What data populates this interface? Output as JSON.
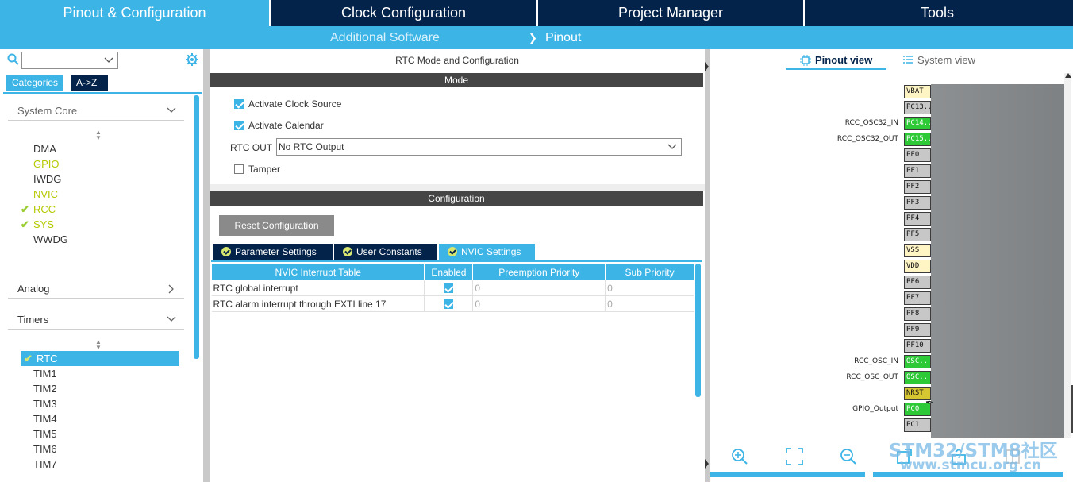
{
  "top_tabs": [
    "Pinout & Configuration",
    "Clock Configuration",
    "Project Manager",
    "Tools"
  ],
  "sub_menu": {
    "additional_software": "Additional Software",
    "pinout": "Pinout"
  },
  "left": {
    "search_value": "",
    "category_tab": "Categories",
    "az_tab": "A->Z",
    "system_core": {
      "label": "System Core",
      "items": [
        "DMA",
        "GPIO",
        "IWDG",
        "NVIC",
        "RCC",
        "SYS",
        "WWDG"
      ]
    },
    "analog": {
      "label": "Analog"
    },
    "timers": {
      "label": "Timers",
      "items": [
        "RTC",
        "TIM1",
        "TIM2",
        "TIM3",
        "TIM4",
        "TIM5",
        "TIM6",
        "TIM7"
      ]
    }
  },
  "mid": {
    "title": "RTC Mode and Configuration",
    "mode_header": "Mode",
    "activate_clock_source": "Activate Clock Source",
    "activate_calendar": "Activate Calendar",
    "rtc_out_label": "RTC OUT",
    "rtc_out_value": "No RTC Output",
    "tamper": "Tamper",
    "config_header": "Configuration",
    "reset_button": "Reset Configuration",
    "tabs": [
      "Parameter Settings",
      "User Constants",
      "NVIC Settings"
    ],
    "table": {
      "headers": [
        "NVIC Interrupt Table",
        "Enabled",
        "Preemption Priority",
        "Sub Priority"
      ],
      "rows": [
        {
          "name": "RTC global interrupt",
          "enabled": true,
          "preemption": "0",
          "sub": "0"
        },
        {
          "name": "RTC alarm interrupt through EXTI line 17",
          "enabled": true,
          "preemption": "0",
          "sub": "0"
        }
      ]
    }
  },
  "right": {
    "pinout_view": "Pinout view",
    "system_view": "System view",
    "pins": [
      "VBAT",
      "PC13..",
      "PC14..",
      "PC15..",
      "PF0",
      "PF1",
      "PF2",
      "PF3",
      "PF4",
      "PF5",
      "VSS",
      "VDD",
      "PF6",
      "PF7",
      "PF8",
      "PF9",
      "PF10",
      "OSC..",
      "OSC..",
      "NRST",
      "PC0",
      "PC1"
    ],
    "pin_labels": {
      "pc14": "RCC_OSC32_IN",
      "pc15": "RCC_OSC32_OUT",
      "osc_in": "RCC_OSC_IN",
      "osc_out": "RCC_OSC_OUT",
      "pc0": "GPIO_Output"
    },
    "watermark": "STM32/STM8社区",
    "watermark_url": "www.stmcu.org.cn"
  },
  "colors": {
    "navy": "#03234b",
    "blue": "#3cb4e6",
    "green_pin": "#2dc937",
    "lime_check": "#9acd32"
  }
}
